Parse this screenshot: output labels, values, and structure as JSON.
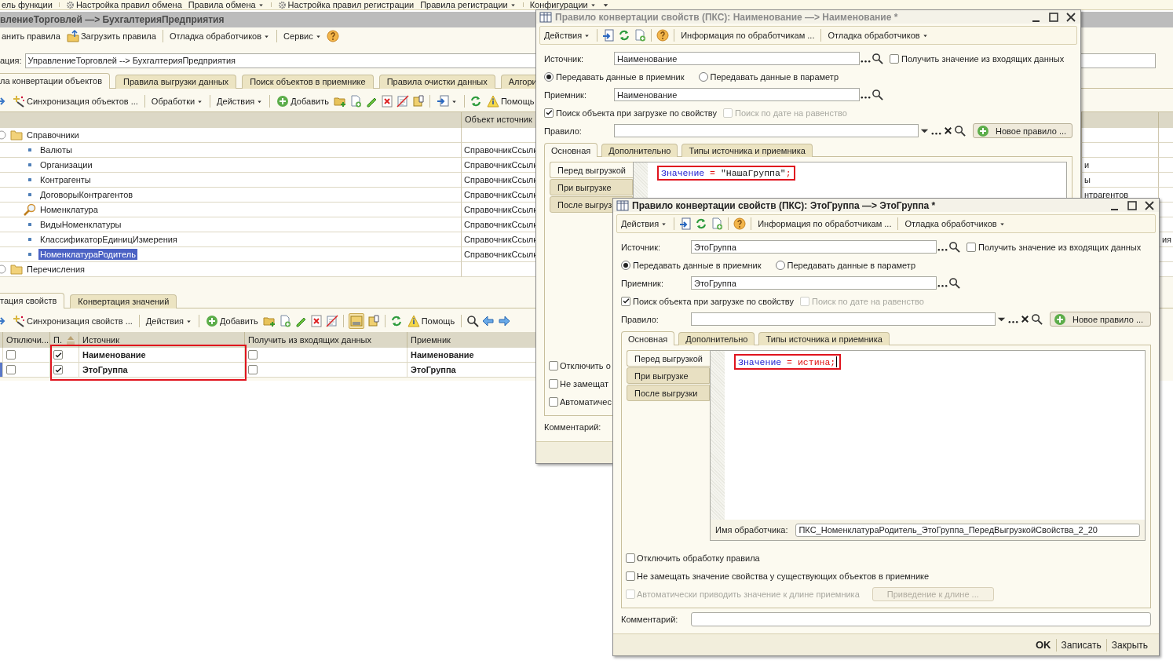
{
  "top_bar": [
    {
      "label": "ель функции",
      "kind": "button"
    },
    {
      "kind": "separator"
    },
    {
      "label": "Настройка правил обмена",
      "kind": "icon_button"
    },
    {
      "label": "Правила обмена",
      "kind": "menu"
    },
    {
      "kind": "separator"
    },
    {
      "label": "Настройка правил регистрации",
      "kind": "icon_button"
    },
    {
      "label": "Правила регистрации",
      "kind": "menu"
    },
    {
      "kind": "separator"
    },
    {
      "label": "Конфигурации",
      "kind": "menu"
    },
    {
      "kind": "icon"
    }
  ],
  "main_window": {
    "title": "влениеТорговлей —> БухгалтерияПредприятия",
    "toolbar": [
      {
        "label": "анить правила",
        "kind": "button"
      },
      {
        "label": "Загрузить правила",
        "kind": "icon_button"
      },
      {
        "kind": "separator"
      },
      {
        "label": "Отладка обработчиков",
        "kind": "menu"
      },
      {
        "kind": "separator"
      },
      {
        "label": "Сервис",
        "kind": "menu"
      },
      {
        "kind": "help"
      }
    ],
    "conversion": {
      "label": "ация:",
      "value": "УправлениеТорговлей --> БухгалтерияПредприятия"
    },
    "tabs": [
      {
        "label": "ла конвертации объектов",
        "selected": true
      },
      {
        "label": "Правила выгрузки данных",
        "selected": false
      },
      {
        "label": "Поиск объектов в приемнике",
        "selected": false
      },
      {
        "label": "Правила очистки данных",
        "selected": false
      },
      {
        "label": "Алгори",
        "selected": false
      }
    ],
    "objects_toolbar": [
      {
        "kind": "icon"
      },
      {
        "label": "Синхронизация объектов ...",
        "kind": "icon_button"
      },
      {
        "kind": "separator"
      },
      {
        "label": "Обработки",
        "kind": "menu"
      },
      {
        "kind": "separator"
      },
      {
        "label": "Действия",
        "kind": "menu"
      },
      {
        "kind": "separator"
      },
      {
        "label": "Добавить",
        "kind": "icon_button"
      },
      {
        "kind": "icon"
      },
      {
        "kind": "icon"
      },
      {
        "kind": "icon"
      },
      {
        "kind": "icon"
      },
      {
        "kind": "icon"
      },
      {
        "kind": "icon"
      },
      {
        "kind": "separator"
      },
      {
        "kind": "icon_menu"
      },
      {
        "kind": "separator"
      },
      {
        "kind": "icon"
      },
      {
        "label": "Помощь",
        "kind": "icon_button"
      }
    ],
    "objects_table": {
      "columns": [
        "Объект источник"
      ],
      "rows": [
        {
          "name": "Справочники",
          "kind": "folder",
          "selected": false,
          "children": [
            {
              "name": "Валюты",
              "kind": "rule",
              "source": "СправочникСсылк",
              "selected": false
            },
            {
              "name": "Организации",
              "kind": "rule",
              "source": "СправочникСсылк",
              "column_3": "и",
              "selected": false
            },
            {
              "name": "Контрагенты",
              "kind": "rule",
              "source": "СправочникСсылк",
              "column_3": "ы",
              "selected": false
            },
            {
              "name": "ДоговорыКонтрагентов",
              "kind": "rule",
              "source": "СправочникСсылк",
              "column_3": "нтрагентов",
              "selected": false
            },
            {
              "name": "Номенклатура",
              "kind": "search",
              "source": "СправочникСсылк",
              "selected": false
            },
            {
              "name": "ВидыНоменклатуры",
              "kind": "rule",
              "source": "СправочникСсылк",
              "selected": false
            },
            {
              "name": "КлассификаторЕдиницИзмерения",
              "kind": "rule",
              "source": "СправочникСсылк",
              "column_4": "ия",
              "selected": false
            },
            {
              "name": "НоменклатураРодитель",
              "kind": "rule",
              "source": "СправочникСсылк",
              "selected": true
            }
          ]
        },
        {
          "name": "Перечисления",
          "kind": "folder",
          "selected": false
        }
      ]
    },
    "property_tabs": [
      {
        "label": "тация свойств",
        "selected": true
      },
      {
        "label": "Конвертация значений",
        "selected": false
      }
    ],
    "properties_toolbar": [
      {
        "kind": "icon",
        "pressed": false
      },
      {
        "label": "Синхронизация свойств ...",
        "kind": "icon_button"
      },
      {
        "kind": "separator"
      },
      {
        "label": "Действия",
        "kind": "menu"
      },
      {
        "kind": "separator"
      },
      {
        "label": "Добавить",
        "kind": "icon_button"
      },
      {
        "kind": "icon",
        "pressed": false
      },
      {
        "kind": "icon",
        "pressed": false
      },
      {
        "kind": "icon",
        "pressed": false
      },
      {
        "kind": "icon",
        "pressed": false
      },
      {
        "kind": "icon",
        "pressed": false
      },
      {
        "kind": "separator"
      },
      {
        "kind": "icon",
        "pressed": true
      },
      {
        "kind": "icon",
        "pressed": false
      },
      {
        "kind": "separator"
      },
      {
        "kind": "icon",
        "pressed": false
      },
      {
        "label": "Помощь",
        "kind": "icon_button"
      },
      {
        "kind": "separator"
      },
      {
        "kind": "icon",
        "pressed": false
      },
      {
        "kind": "icon",
        "pressed": false
      },
      {
        "kind": "icon",
        "pressed": false
      }
    ],
    "properties_table": {
      "columns": [
        "Отключи...",
        "П.",
        "Источник",
        "Получить из входящих данных",
        "Приемник"
      ],
      "highlighted": true,
      "rows": [
        {
          "off": false,
          "p_checked": true,
          "source": "Наименование",
          "get_incoming": false,
          "receiver": "Наименование",
          "current": false
        },
        {
          "off": false,
          "p_checked": true,
          "source": "ЭтоГруппа",
          "get_incoming": false,
          "receiver": "ЭтоГруппа",
          "current": true
        }
      ]
    }
  },
  "windows": [
    {
      "title": "Правило конвертации свойств (ПКС): Наименование —> Наименование *",
      "active": false,
      "toolbar": [
        {
          "label": "Действия",
          "kind": "menu"
        },
        {
          "kind": "separator"
        },
        {
          "kind": "icon"
        },
        {
          "kind": "icon"
        },
        {
          "kind": "icon"
        },
        {
          "kind": "separator"
        },
        {
          "kind": "help"
        },
        {
          "kind": "separator"
        },
        {
          "label": "Информация по обработчикам ...",
          "kind": "button"
        },
        {
          "kind": "separator"
        },
        {
          "label": "Отладка обработчиков",
          "kind": "menu"
        }
      ],
      "source": {
        "label": "Источник:",
        "value": "Наименование"
      },
      "get_from_incoming": {
        "label": "Получить значение из входящих данных",
        "checked": false
      },
      "transfer": [
        {
          "label": "Передавать данные в приемник",
          "selected": true
        },
        {
          "label": "Передавать данные в параметр",
          "selected": false
        }
      ],
      "receiver": {
        "label": "Приемник:",
        "value": "Наименование"
      },
      "search_options": [
        {
          "label": "Поиск объекта при загрузке по свойству",
          "checked": true,
          "disabled": false
        },
        {
          "label": "Поиск по дате на равенство",
          "checked": false,
          "disabled": true
        }
      ],
      "rule": {
        "label": "Правило:",
        "button": "Новое правило ..."
      },
      "tabs": [
        {
          "label": "Основная",
          "selected": true
        },
        {
          "label": "Дополнительно",
          "selected": false
        },
        {
          "label": "Типы источника и приемника",
          "selected": false
        }
      ],
      "handler_tabs": [
        {
          "label": "Перед выгрузкой",
          "selected": true
        },
        {
          "label": "При выгрузке",
          "selected": false
        },
        {
          "label": "После выгруз",
          "selected": false
        }
      ],
      "code": {
        "highlighted": true,
        "tokens": [
          {
            "text": "Значение",
            "kind": "identifier"
          },
          {
            "text": " = ",
            "kind": "operator"
          },
          {
            "text": "\"НашаГруппа\"",
            "kind": "string"
          },
          {
            "text": ";",
            "kind": "operator"
          }
        ]
      },
      "options": [
        {
          "label": "Отключить о",
          "checked": false,
          "disabled": false
        },
        {
          "label": "Не замещат",
          "checked": false,
          "disabled": false
        },
        {
          "label": "Автоматичес",
          "checked": false,
          "disabled": false
        }
      ],
      "comment": {
        "label": "Комментарий:"
      }
    },
    {
      "title": "Правило конвертации свойств (ПКС): ЭтоГруппа —> ЭтоГруппа *",
      "active": true,
      "toolbar": [
        {
          "label": "Действия",
          "kind": "menu"
        },
        {
          "kind": "separator"
        },
        {
          "kind": "icon"
        },
        {
          "kind": "icon"
        },
        {
          "kind": "icon"
        },
        {
          "kind": "separator"
        },
        {
          "kind": "help"
        },
        {
          "kind": "separator"
        },
        {
          "label": "Информация по обработчикам ...",
          "kind": "button"
        },
        {
          "kind": "separator"
        },
        {
          "label": "Отладка обработчиков",
          "kind": "menu"
        }
      ],
      "source": {
        "label": "Источник:",
        "value": "ЭтоГруппа"
      },
      "get_from_incoming": {
        "label": "Получить значение из входящих данных",
        "checked": false
      },
      "transfer": [
        {
          "label": "Передавать данные в приемник",
          "selected": true
        },
        {
          "label": "Передавать данные в параметр",
          "selected": false
        }
      ],
      "receiver": {
        "label": "Приемник:",
        "value": "ЭтоГруппа"
      },
      "search_options": [
        {
          "label": "Поиск объекта при загрузке по свойству",
          "checked": true,
          "disabled": false
        },
        {
          "label": "Поиск по дате на равенство",
          "checked": false,
          "disabled": true
        }
      ],
      "rule": {
        "label": "Правило:",
        "button": "Новое правило ..."
      },
      "tabs": [
        {
          "label": "Основная",
          "selected": true
        },
        {
          "label": "Дополнительно",
          "selected": false
        },
        {
          "label": "Типы источника и приемника",
          "selected": false
        }
      ],
      "handler_tabs": [
        {
          "label": "Перед выгрузкой",
          "selected": true
        },
        {
          "label": "При выгрузке",
          "selected": false
        },
        {
          "label": "После выгрузки",
          "selected": false
        }
      ],
      "code": {
        "highlighted": true,
        "cursor": true,
        "tokens": [
          {
            "text": "Значение",
            "kind": "identifier"
          },
          {
            "text": " = ",
            "kind": "operator"
          },
          {
            "text": "истина;",
            "kind": "keyword"
          }
        ]
      },
      "handler_name": {
        "label": "Имя обработчика:",
        "value": "ПКС_НоменклатураРодитель_ЭтоГруппа_ПередВыгрузкойСвойства_2_20"
      },
      "options": [
        {
          "label": "Отключить обработку правила",
          "checked": false,
          "disabled": false
        },
        {
          "label": "Не замещать значение свойства у существующих объектов в приемнике",
          "checked": false,
          "disabled": false
        },
        {
          "label": "Автоматически приводить значение к длине приемника",
          "checked": false,
          "disabled": true,
          "button": {
            "label": "Приведение к длине ...",
            "disabled": true
          }
        }
      ],
      "comment": {
        "label": "Комментарий:",
        "field": true
      },
      "footer_buttons": [
        {
          "label": "OK",
          "default": true
        },
        {
          "label": "Записать",
          "default": false
        },
        {
          "label": "Закрыть",
          "default": false
        }
      ]
    }
  ]
}
